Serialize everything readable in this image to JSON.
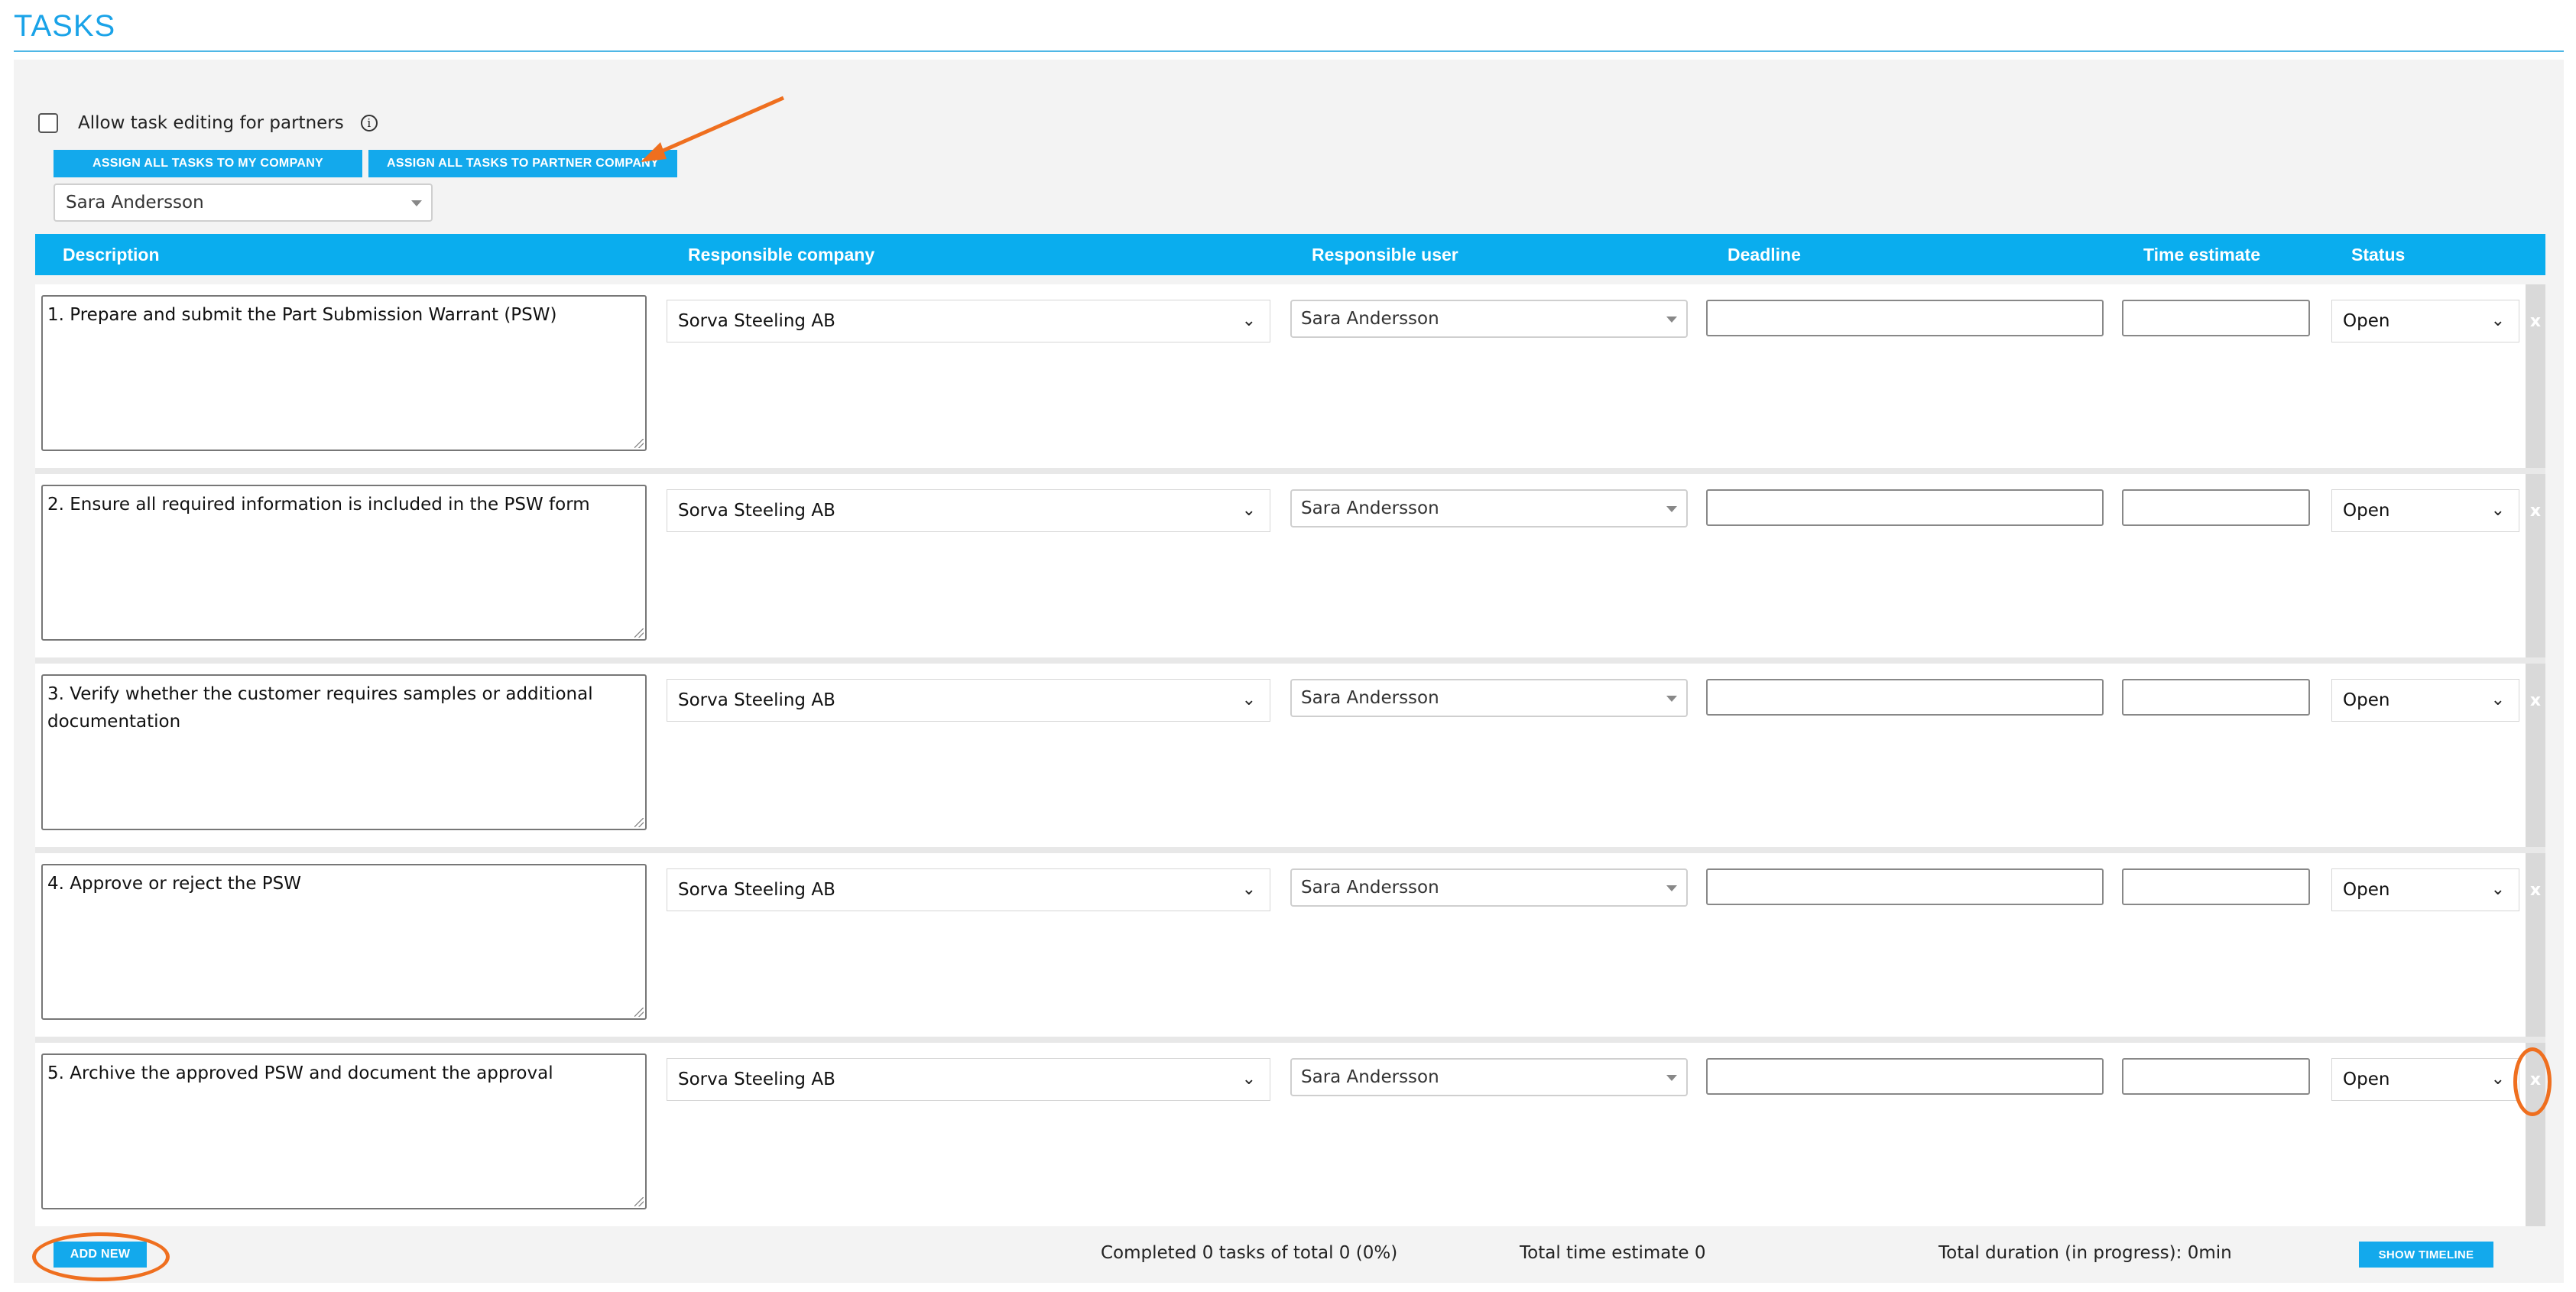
{
  "page": {
    "title": "TASKS"
  },
  "controls": {
    "allow_label": "Allow task editing for partners",
    "info_glyph": "i",
    "assign_my_label": "ASSIGN ALL TASKS TO MY COMPANY",
    "assign_partner_label": "ASSIGN ALL TASKS TO PARTNER COMPANY",
    "user_select_value": "Sara Andersson"
  },
  "table": {
    "headers": {
      "description": "Description",
      "responsible_company": "Responsible company",
      "responsible_user": "Responsible user",
      "deadline": "Deadline",
      "time_estimate": "Time estimate",
      "status": "Status"
    },
    "rows": [
      {
        "description": "1. Prepare and submit the Part Submission Warrant (PSW)",
        "company": "Sorva Steeling AB",
        "user": "Sara Andersson",
        "deadline": "",
        "time_estimate": "",
        "status": "Open",
        "remove": "x"
      },
      {
        "description": "2. Ensure all required information is included in the PSW form",
        "company": "Sorva Steeling AB",
        "user": "Sara Andersson",
        "deadline": "",
        "time_estimate": "",
        "status": "Open",
        "remove": "x"
      },
      {
        "description": "3. Verify whether the customer requires samples or additional documentation",
        "company": "Sorva Steeling AB",
        "user": "Sara Andersson",
        "deadline": "",
        "time_estimate": "",
        "status": "Open",
        "remove": "x"
      },
      {
        "description": "4. Approve or reject the PSW",
        "company": "Sorva Steeling AB",
        "user": "Sara Andersson",
        "deadline": "",
        "time_estimate": "",
        "status": "Open",
        "remove": "x"
      },
      {
        "description": "5. Archive the approved PSW and document the approval",
        "company": "Sorva Steeling AB",
        "user": "Sara Andersson",
        "deadline": "",
        "time_estimate": "",
        "status": "Open",
        "remove": "x"
      }
    ]
  },
  "footer": {
    "add_new_label": "ADD NEW",
    "completed_text": "Completed 0 tasks of total 0 (0%)",
    "total_time_text": "Total time estimate 0",
    "total_duration_text": "Total duration (in progress): 0min",
    "show_timeline_label": "SHOW TIMELINE"
  },
  "icons": {
    "chevron": "chevron-down-icon",
    "dropdown_triangle": "triangle-down-icon",
    "info": "info-icon",
    "remove": "close-icon"
  },
  "colors": {
    "accent": "#13a9ec",
    "header_bg": "#0aadee",
    "annotation": "#ef6f1f",
    "panel_bg": "#f3f3f3"
  }
}
